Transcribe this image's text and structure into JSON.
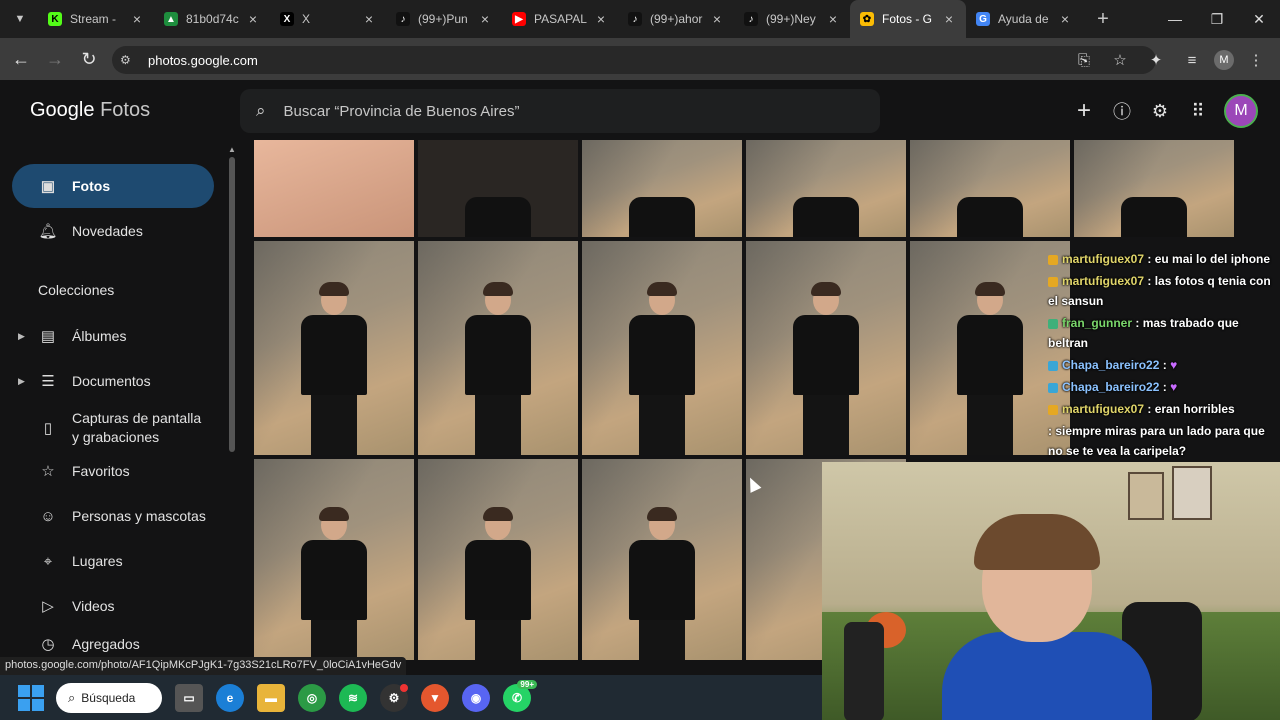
{
  "browser": {
    "tabs": [
      {
        "title": "Stream - ",
        "favicon": "kick-icon",
        "color": "#53fc18"
      },
      {
        "title": "81b0d74c",
        "favicon": "drive-icon",
        "color": "#1e8e3e"
      },
      {
        "title": "X",
        "favicon": "x-icon",
        "color": "#000000"
      },
      {
        "title": "(99+)Pun",
        "favicon": "tiktok-icon",
        "color": "#111111"
      },
      {
        "title": "PASAPAL",
        "favicon": "youtube-icon",
        "color": "#ff0000"
      },
      {
        "title": "(99+)ahor",
        "favicon": "tiktok-icon",
        "color": "#111111"
      },
      {
        "title": "(99+)Ney",
        "favicon": "tiktok-icon",
        "color": "#111111"
      },
      {
        "title": "Fotos - G",
        "favicon": "google-photos-icon",
        "color": "#fbbc04",
        "active": true
      },
      {
        "title": "Ayuda de",
        "favicon": "google-icon",
        "color": "#4285f4"
      }
    ],
    "url": "photos.google.com"
  },
  "photos": {
    "logo_google": "Google",
    "logo_fotos": "Fotos",
    "search_placeholder": "Buscar “Provincia de Buenos Aires”",
    "sidebar": {
      "items": [
        {
          "label": "Fotos",
          "icon": "photo-icon"
        },
        {
          "label": "Novedades",
          "icon": "bell-icon"
        },
        {
          "label": "Álbumes",
          "icon": "album-icon"
        },
        {
          "label": "Documentos",
          "icon": "document-icon"
        },
        {
          "label": "Capturas de pantalla y grabaciones",
          "icon": "screenshot-icon"
        },
        {
          "label": "Favoritos",
          "icon": "star-icon"
        },
        {
          "label": "Personas y mascotas",
          "icon": "people-icon"
        },
        {
          "label": "Lugares",
          "icon": "location-icon"
        },
        {
          "label": "Videos",
          "icon": "play-icon"
        },
        {
          "label": "Agregados",
          "icon": "clock-icon"
        }
      ],
      "collections_heading": "Colecciones"
    },
    "status_url": "photos.google.com/photo/AF1QipMKcPJgK1-7g33S21cLRo7FV_0loCiA1vHeGdv"
  },
  "chat": [
    {
      "user": "martufiguex07",
      "text": ": eu mai lo del iphone"
    },
    {
      "user": "martufiguex07",
      "text": ": las fotos q tenia con el sansun"
    },
    {
      "user": "fran_gunner",
      "text": ": mas trabado que beltran"
    },
    {
      "user": "Chapa_bareiro22",
      "text": ":"
    },
    {
      "user": "Chapa_bareiro22",
      "text": ":"
    },
    {
      "user": "martufiguex07",
      "text": ": eran horribles"
    },
    {
      "user": "",
      "text": ": siempre miras para un lado para que no se te vea la caripela?"
    }
  ],
  "taskbar": {
    "search_label": "Búsqueda",
    "whatsapp_badge": "99+"
  }
}
